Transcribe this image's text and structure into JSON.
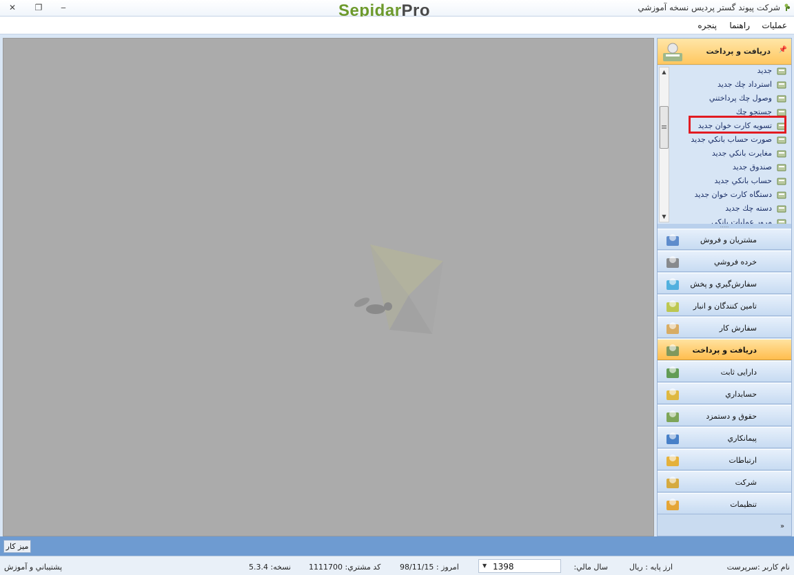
{
  "window": {
    "title": "شرکت پیوند گستر پردیس نسخه آموزشي",
    "logo_part1": "Sepidar",
    "logo_part2": "Pro",
    "close_glyph": "✕",
    "restore_glyph": "❐",
    "minimize_glyph": "‒"
  },
  "menu": {
    "items": [
      "عملیات",
      "راهنما",
      "پنجره"
    ]
  },
  "panel": {
    "header_title": "دریافت و پرداخت",
    "tasks": [
      {
        "label": "جدید",
        "icon": "new-doc-icon"
      },
      {
        "label": "استرداد چك جديد",
        "icon": "check-return-icon"
      },
      {
        "label": "وصول چك پرداختني",
        "icon": "check-collect-icon"
      },
      {
        "label": "جستجو چك",
        "icon": "check-search-icon"
      },
      {
        "label": "تسويه کارت خوان جديد",
        "icon": "card-settle-icon"
      },
      {
        "label": "صورت حساب بانکي جديد",
        "icon": "bank-statement-icon"
      },
      {
        "label": "مغايرت بانکي جديد",
        "icon": "bank-reconcile-icon"
      },
      {
        "label": "صندوق جديد",
        "icon": "cashbox-icon"
      },
      {
        "label": "حساب بانکي جديد",
        "icon": "bank-account-icon"
      },
      {
        "label": "دستگاه کارت خوان جديد",
        "icon": "card-reader-icon"
      },
      {
        "label": "دسته چك جديد",
        "icon": "checkbook-icon"
      },
      {
        "label": "مرور عمليات بانکي",
        "icon": "bank-ops-icon"
      }
    ],
    "modules": [
      {
        "label": "مشتریان و فروش",
        "icon": "sales-chart-icon",
        "color": "#4a7cc4"
      },
      {
        "label": "خرده فروشي",
        "icon": "shopping-cart-icon",
        "color": "#7a7a7a"
      },
      {
        "label": "سفارش‌گيري و پخش",
        "icon": "distribution-icon",
        "color": "#3aa7d9"
      },
      {
        "label": "تامين كنندگان و انبار",
        "icon": "warehouse-icon",
        "color": "#b8c234"
      },
      {
        "label": "سفارش كار",
        "icon": "work-order-icon",
        "color": "#d8a24a"
      },
      {
        "label": "دریافت و پرداخت",
        "icon": "payment-icon",
        "color": "#6a8f5a",
        "active": true
      },
      {
        "label": "دارایی ثابت",
        "icon": "fixed-assets-icon",
        "color": "#4f8f3a"
      },
      {
        "label": "حسابداري",
        "icon": "accounting-icon",
        "color": "#e0b020"
      },
      {
        "label": "حقوق و دستمزد",
        "icon": "payroll-icon",
        "color": "#6f9a3c"
      },
      {
        "label": "پیمانکاري",
        "icon": "contracting-icon",
        "color": "#2f6fbf"
      },
      {
        "label": "ارتباطات",
        "icon": "communications-icon",
        "color": "#e8a81a"
      },
      {
        "label": "شرکت",
        "icon": "company-icon",
        "color": "#d6a020"
      },
      {
        "label": "تنظیمات",
        "icon": "settings-gear-icon",
        "color": "#e89a14"
      }
    ],
    "expand_glyph": "»"
  },
  "taskbar": {
    "desk_tab": "میز کار"
  },
  "status": {
    "user": "نام کاربر :سرپرست",
    "base_currency": "ارز پایه :   ریال",
    "fiscal_year_label": "سال مالي:",
    "fiscal_year": "1398",
    "today": "امروز :   98/11/15",
    "customer_code": "كد مشتري:   1111700",
    "version": "نسخه:   5.3.4",
    "support": "پشتیباني و آموزش"
  },
  "colors": {
    "highlight": "#e21b22",
    "workspace": "#ababab",
    "active_module": "#ffbd4e"
  }
}
